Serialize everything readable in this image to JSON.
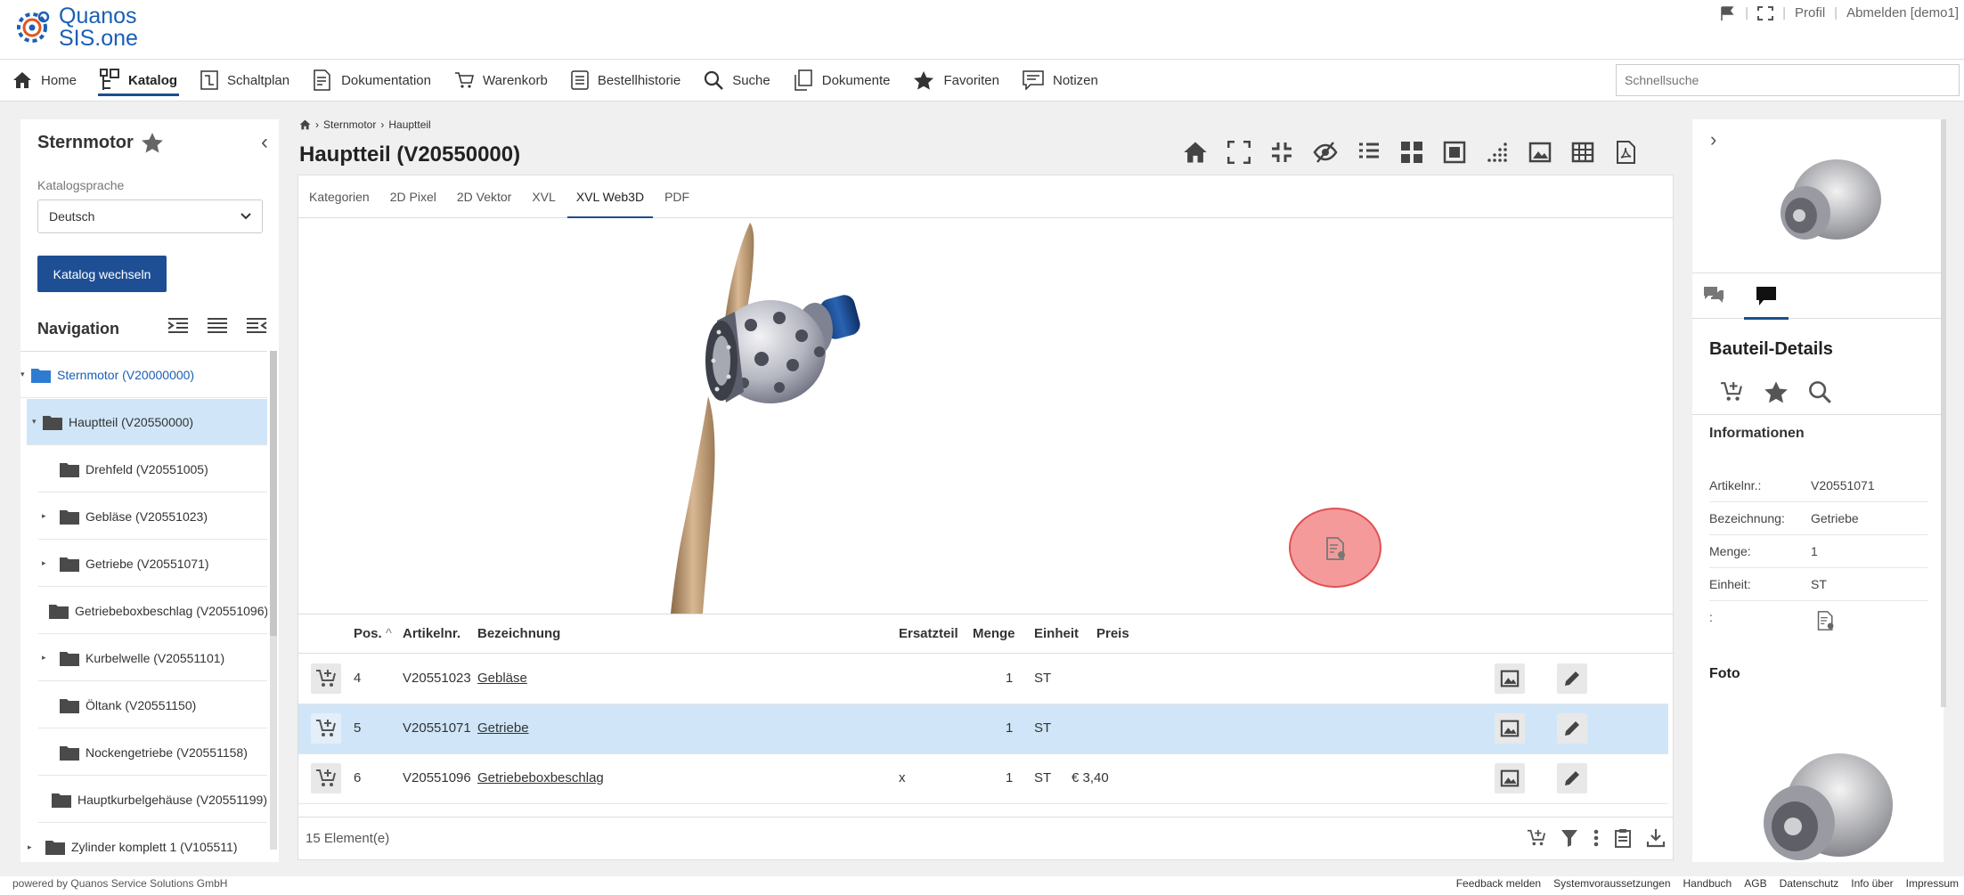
{
  "app": {
    "logo_line1": "Quanos",
    "logo_line2": "SIS.one"
  },
  "toplinks": {
    "profile": "Profil",
    "logout": "Abmelden [demo1]"
  },
  "mainnav": {
    "home": "Home",
    "catalog": "Katalog",
    "schematic": "Schaltplan",
    "documentation": "Dokumentation",
    "cart": "Warenkorb",
    "order_history": "Bestellhistorie",
    "search": "Suche",
    "documents": "Dokumente",
    "favorites": "Favoriten",
    "notes": "Notizen",
    "quicksearch_placeholder": "Schnellsuche"
  },
  "left": {
    "title": "Sternmotor",
    "language_label": "Katalogsprache",
    "language_value": "Deutsch",
    "switch_button": "Katalog wechseln",
    "navigation_label": "Navigation",
    "tree": [
      {
        "label": "Sternmotor (V20000000)",
        "expanded": true,
        "level": 0
      },
      {
        "label": "Hauptteil (V20550000)",
        "expanded": true,
        "level": 1,
        "selected": true
      },
      {
        "label": "Drehfeld (V20551005)",
        "level": 2
      },
      {
        "label": "Gebläse (V20551023)",
        "level": 2,
        "has_children": true
      },
      {
        "label": "Getriebe (V20551071)",
        "level": 2,
        "has_children": true
      },
      {
        "label": "Getriebeboxbeschlag (V20551096)",
        "level": 2
      },
      {
        "label": "Kurbelwelle (V20551101)",
        "level": 2,
        "has_children": true
      },
      {
        "label": "Öltank (V20551150)",
        "level": 2
      },
      {
        "label": "Nockengetriebe (V20551158)",
        "level": 2
      },
      {
        "label": "Hauptkurbelgehäuse (V20551199)",
        "level": 2
      },
      {
        "label": "Zylinder komplett 1 (V105511)",
        "level": 1,
        "has_children": true
      }
    ]
  },
  "center": {
    "breadcrumb": [
      "Sternmotor",
      "Hauptteil"
    ],
    "title": "Hauptteil (V20550000)",
    "tabs": [
      "Kategorien",
      "2D Pixel",
      "2D Vektor",
      "XVL",
      "XVL Web3D",
      "PDF"
    ],
    "active_tab": "XVL Web3D",
    "columns": {
      "pos": "Pos.",
      "sort_indicator": "^",
      "article": "Artikelnr.",
      "designation": "Bezeichnung",
      "spare": "Ersatzteil",
      "qty": "Menge",
      "unit": "Einheit",
      "price": "Preis"
    },
    "rows": [
      {
        "pos": "4",
        "article": "V20551023",
        "designation": "Gebläse",
        "spare": "",
        "qty": "1",
        "unit": "ST",
        "price": ""
      },
      {
        "pos": "5",
        "article": "V20551071",
        "designation": "Getriebe",
        "spare": "",
        "qty": "1",
        "unit": "ST",
        "price": ""
      },
      {
        "pos": "6",
        "article": "V20551096",
        "designation": "Getriebeboxbeschlag",
        "spare": "x",
        "qty": "1",
        "unit": "ST",
        "price": "€ 3,40"
      }
    ],
    "selected_row": 1,
    "element_count": "15 Element(e)"
  },
  "right": {
    "section_title": "Bauteil-Details",
    "info_title": "Informationen",
    "info": [
      {
        "key": "Artikelnr.:",
        "value": "V20551071"
      },
      {
        "key": "Bezeichnung:",
        "value": "Getriebe"
      },
      {
        "key": "Menge:",
        "value": "1"
      },
      {
        "key": "Einheit:",
        "value": "ST"
      },
      {
        "key": ":",
        "value": ""
      }
    ],
    "photo_title": "Foto"
  },
  "footer": {
    "powered_by": "powered by Quanos Service Solutions GmbH",
    "links": [
      "Feedback melden",
      "Systemvoraussetzungen",
      "Handbuch",
      "AGB",
      "Datenschutz",
      "Info über",
      "Impressum"
    ]
  },
  "colors": {
    "brand": "#1a5fb4",
    "primary_button": "#1e4f95",
    "selection": "#d0e6f8",
    "folder": "#4a4a4a",
    "root_folder": "#2f7bd1"
  }
}
